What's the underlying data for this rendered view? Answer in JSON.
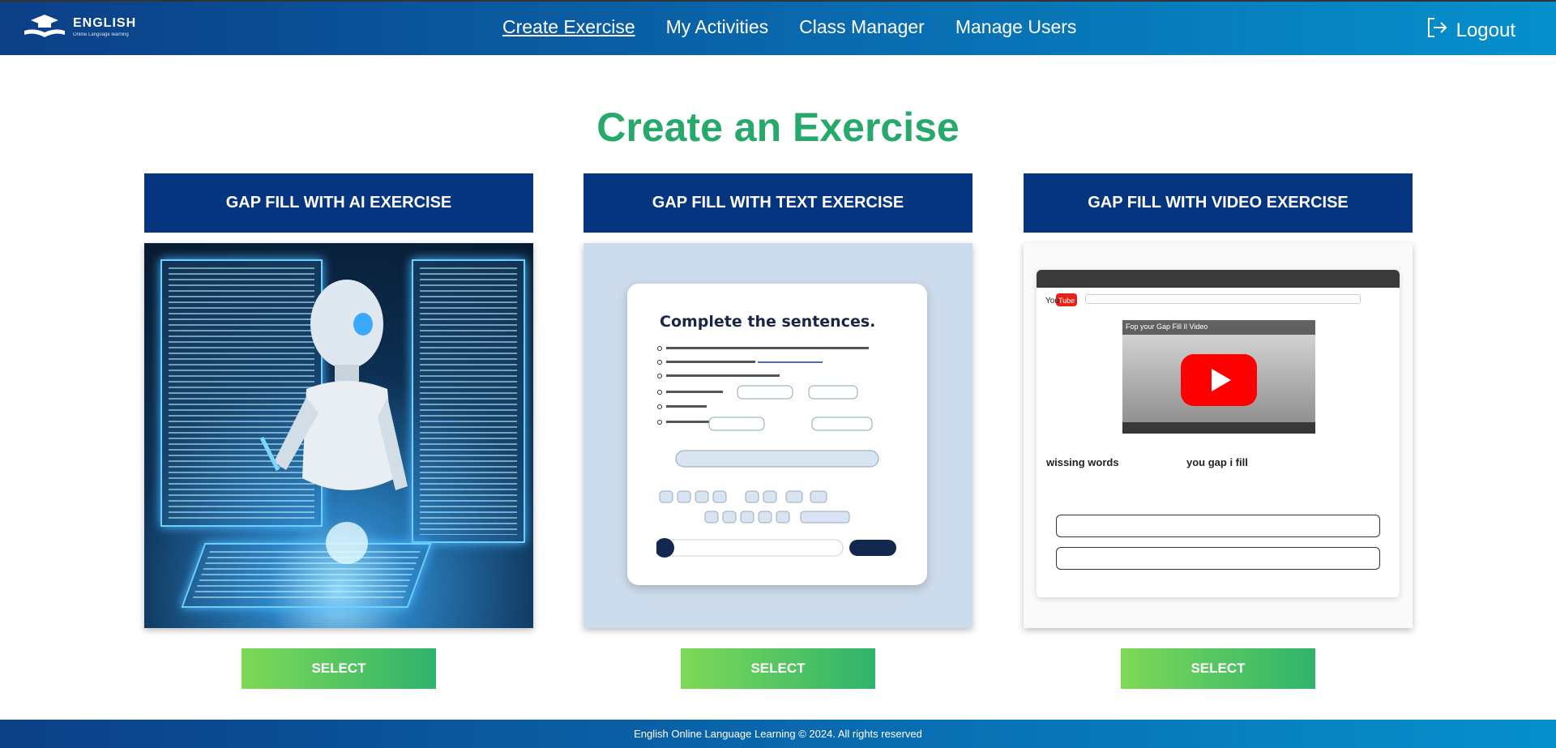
{
  "brand": {
    "title": "ENGLISH",
    "subtitle": "Online Language learning"
  },
  "nav": [
    {
      "label": "Create Exercise",
      "active": true
    },
    {
      "label": "My Activities",
      "active": false
    },
    {
      "label": "Class Manager",
      "active": false
    },
    {
      "label": "Manage Users",
      "active": false
    }
  ],
  "logout_label": "Logout",
  "page_title": "Create an Exercise",
  "cards": [
    {
      "title": "GAP FILL WITH AI EXERCISE",
      "button": "SELECT"
    },
    {
      "title": "GAP FILL WITH TEXT EXERCISE",
      "button": "SELECT"
    },
    {
      "title": "GAP FILL WITH VIDEO EXERCISE",
      "button": "SELECT"
    }
  ],
  "text_card_art": {
    "heading": "Complete the sentences."
  },
  "video_card_art": {
    "video_title": "Fop your Gap Fill Il Video",
    "caption_left": "wissing words",
    "caption_right": "you gap i fill"
  },
  "footer_text": "English Online Language Learning © 2024. All rights reserved",
  "colors": {
    "nav_gradient_start": "#0b3f86",
    "nav_gradient_end": "#0690cc",
    "title_green": "#27a96b",
    "card_header": "#06357f",
    "button_start": "#7ed957",
    "button_end": "#2fb36c"
  }
}
